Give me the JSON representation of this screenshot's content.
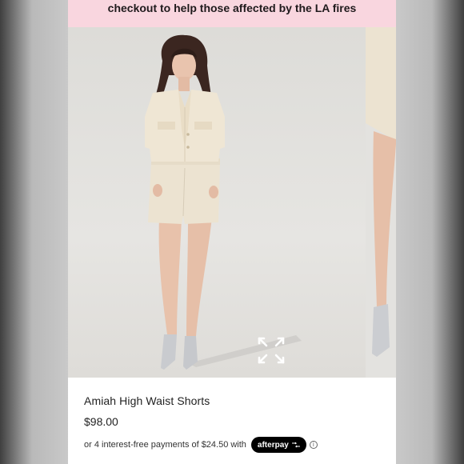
{
  "banner": {
    "text": "checkout to help those affected by the LA fires"
  },
  "gallery": {
    "main_image": "model-in-cream-cropped-blazer-and-shorts",
    "next_image": "model-legs-cream-shorts-partial",
    "expand_icon": "expand-arrows-icon"
  },
  "product": {
    "title": "Amiah High Waist Shorts",
    "price": "$98.00"
  },
  "afterpay": {
    "prefix": "or 4 interest-free payments of",
    "amount": "$24.50",
    "suffix": "with",
    "badge_label": "afterpay",
    "info_icon": "ⓘ"
  },
  "colors": {
    "banner_bg": "#f9d6df",
    "badge_bg": "#000000",
    "outfit": "#ece3d1"
  }
}
